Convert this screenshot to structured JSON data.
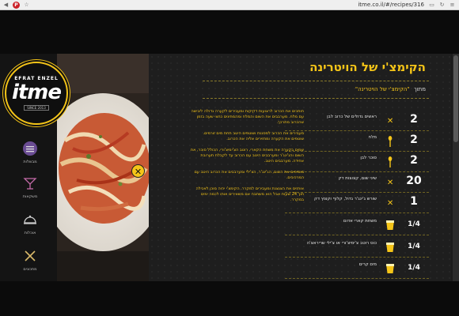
{
  "browser": {
    "url": "itme.co.il/#/recipes/316"
  },
  "logo": {
    "arc_text": "EFRAT ENZEL",
    "brand": "itme",
    "sub": "SINCE 2013"
  },
  "sidebar": {
    "items": [
      {
        "label": "מבשלות",
        "icon": "pot-icon"
      },
      {
        "label": "משקאות",
        "icon": "cocktail-icon"
      },
      {
        "label": "אוכלות",
        "icon": "cloche-icon"
      },
      {
        "label": "מתכונים",
        "icon": "utensils-icon"
      }
    ]
  },
  "recipe": {
    "title": "הקימצ'י של הויטרינה",
    "source_label": "מתוך",
    "source_link": "\"הקימצ'י של הויטרינה\"",
    "ingredients": [
      {
        "qty": "2",
        "name": "ראשים גדולים של כרוב לבן",
        "icon": "x"
      },
      {
        "qty": "2",
        "name": "מלח",
        "icon": "spoon"
      },
      {
        "qty": "2",
        "name": "סוכר לבן",
        "icon": "spoon"
      },
      {
        "qty": "20",
        "name": "שיני שום, קצוצות דק",
        "icon": "x"
      },
      {
        "qty": "1",
        "name": "שורש ג'ינג'ר גדול, קלוף וקצוץ דק",
        "icon": "x"
      },
      {
        "qty": "1/4",
        "name": "משחת קארי אדום",
        "icon": "cup"
      },
      {
        "qty": "1/4",
        "name": "כוס רוטב צ'ימיצ'ורי או צ'ילי שריראצ'ה",
        "icon": "cup"
      },
      {
        "qty": "1/4",
        "name": "מים קרים",
        "icon": "cup"
      }
    ],
    "instructions": [
      "חותכים את הכרוב לרצועות דקיקות ומעבירים לקערה גדולה ליבישה עם מלח. מערבבים את השום והמלח ומהמתינים כחצי שעה בזמן שהכרוב מתרכך.",
      "מעבירים את הכרוב למסננת ושוטפים היטב תחת מים זורמים. שוטפים את הקערה ומחזירים אליה את הכרוב.",
      "שמים בקערה את משחת הקארי, רוטב הצ'ימיצ'ורי, הכולל סוכר, את השום והג'ינג'ר ומערבבים היטב עם הכרוב עד לקבלת תערובת אחידה. מערבבים היטב.",
      "מוסיפים את השום, הג'ינג'ר, הצ'ילי ומערבבים את הכרוב היטב עם המרכיבים.",
      "אוחזים את הצנצנת ומעבירים למקרר. הקימצ'י יהיה מוכן לאכילה תוך 24 שעות אבל הוא משתבח אם משאירים אותו לכמה ימים במקרר."
    ]
  },
  "colors": {
    "accent": "#f5c518",
    "background": "#1b1b1b"
  }
}
